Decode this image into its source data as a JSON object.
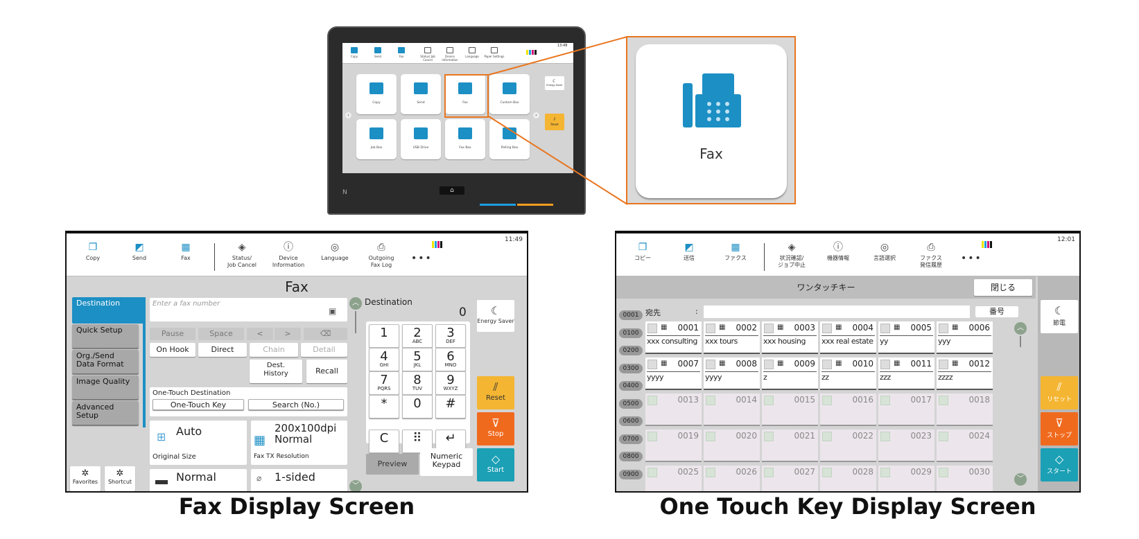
{
  "device": {
    "topbar": [
      "Copy",
      "Send",
      "Fax",
      "Status/ Job Cancel",
      "Device Information",
      "Language",
      "Paper Settings"
    ],
    "clock": "13:48",
    "tiles": [
      "Copy",
      "Send",
      "Fax",
      "Custom Box",
      "Job Box",
      "USB Drive",
      "Fax Box",
      "Polling Box"
    ],
    "side": {
      "energy": "Energy Saver",
      "reset": "Reset"
    }
  },
  "callout": {
    "label": "Fax",
    "icon": "fax-icon"
  },
  "fax_screen": {
    "caption": "Fax Display Screen",
    "clock": "11:49",
    "ink_colors": [
      "#f2e400",
      "#1c9fe0",
      "#d4147a",
      "#111111"
    ],
    "topbar": [
      {
        "label": "Copy",
        "icon": "copy-icon"
      },
      {
        "label": "Send",
        "icon": "send-icon"
      },
      {
        "label": "Fax",
        "icon": "fax-icon"
      },
      {
        "label": "Status/\nJob Cancel",
        "icon": "eye-icon"
      },
      {
        "label": "Device\nInformation",
        "icon": "info-icon"
      },
      {
        "label": "Language",
        "icon": "language-icon"
      },
      {
        "label": "Outgoing\nFax Log",
        "icon": "fax-log-icon"
      }
    ],
    "more": "•••",
    "title": "Fax",
    "tabs": [
      "Destination",
      "Quick Setup",
      "Org./Send Data Format",
      "Image Quality",
      "Advanced Setup"
    ],
    "input_placeholder": "Enter a fax number",
    "edit_buttons": [
      "Pause",
      "Space",
      "<",
      ">",
      "⌫"
    ],
    "mode_buttons": [
      "On Hook",
      "Direct",
      "Chain",
      "Detail"
    ],
    "dest_history": "Dest.\nHistory",
    "recall": "Recall",
    "one_touch_label": "One-Touch Destination",
    "one_touch_key": "One-Touch Key",
    "search_no": "Search (No.)",
    "original_size_value": "Auto",
    "original_size_label": "Original Size",
    "resolution_value": "200x100dpi\nNormal",
    "resolution_label": "Fax TX Resolution",
    "density_value": "Normal",
    "duplex_value": "1-sided",
    "destination_label": "Destination",
    "destination_count": "0",
    "keypad": [
      {
        "n": "1",
        "l": ""
      },
      {
        "n": "2",
        "l": "ABC"
      },
      {
        "n": "3",
        "l": "DEF"
      },
      {
        "n": "4",
        "l": "GHI"
      },
      {
        "n": "5",
        "l": "JKL"
      },
      {
        "n": "6",
        "l": "MNO"
      },
      {
        "n": "7",
        "l": "PQRS"
      },
      {
        "n": "8",
        "l": "TUV"
      },
      {
        "n": "9",
        "l": "WXYZ"
      },
      {
        "n": "*",
        "l": ""
      },
      {
        "n": "0",
        "l": ""
      },
      {
        "n": "#",
        "l": ""
      },
      {
        "n": "C",
        "l": ""
      },
      {
        "n": "⠿",
        "l": ""
      },
      {
        "n": "↵",
        "l": ""
      }
    ],
    "preview": "Preview",
    "numeric_keypad": "Numeric\nKeypad",
    "favorites": "Favorites",
    "shortcut": "Shortcut",
    "side": {
      "energy": "Energy Saver",
      "reset": "Reset",
      "stop": "Stop",
      "start": "Start"
    }
  },
  "otk_screen": {
    "caption": "One Touch Key Display Screen",
    "clock": "12:01",
    "topbar": [
      {
        "label": "コピー",
        "icon": "copy-icon"
      },
      {
        "label": "送信",
        "icon": "send-icon"
      },
      {
        "label": "ファクス",
        "icon": "fax-icon"
      },
      {
        "label": "状況確認/\nジョブ中止",
        "icon": "eye-icon"
      },
      {
        "label": "機器情報",
        "icon": "info-icon"
      },
      {
        "label": "言語選択",
        "icon": "language-icon"
      },
      {
        "label": "ファクス\n発信履歴",
        "icon": "fax-log-icon"
      }
    ],
    "more": "•••",
    "title": "ワンタッチキー",
    "close": "閉じる",
    "dest_label": "宛先",
    "dest_colon": ":",
    "number_button": "番号",
    "index_tabs": [
      "0001",
      "0100",
      "0200",
      "0300",
      "0400",
      "0500",
      "0600",
      "0700",
      "0800",
      "0900"
    ],
    "keys": [
      {
        "num": "0001",
        "name": "xxx consulting"
      },
      {
        "num": "0002",
        "name": "xxx tours"
      },
      {
        "num": "0003",
        "name": "xxx housing"
      },
      {
        "num": "0004",
        "name": "xxx real estate"
      },
      {
        "num": "0005",
        "name": "yy"
      },
      {
        "num": "0006",
        "name": "yyy"
      },
      {
        "num": "0007",
        "name": "yyyy"
      },
      {
        "num": "0008",
        "name": "yyyy"
      },
      {
        "num": "0009",
        "name": "z"
      },
      {
        "num": "0010",
        "name": "zz"
      },
      {
        "num": "0011",
        "name": "zzz"
      },
      {
        "num": "0012",
        "name": "zzzz"
      },
      {
        "num": "0013",
        "name": ""
      },
      {
        "num": "0014",
        "name": ""
      },
      {
        "num": "0015",
        "name": ""
      },
      {
        "num": "0016",
        "name": ""
      },
      {
        "num": "0017",
        "name": ""
      },
      {
        "num": "0018",
        "name": ""
      },
      {
        "num": "0019",
        "name": ""
      },
      {
        "num": "0020",
        "name": ""
      },
      {
        "num": "0021",
        "name": ""
      },
      {
        "num": "0022",
        "name": ""
      },
      {
        "num": "0023",
        "name": ""
      },
      {
        "num": "0024",
        "name": ""
      },
      {
        "num": "0025",
        "name": ""
      },
      {
        "num": "0026",
        "name": ""
      },
      {
        "num": "0027",
        "name": ""
      },
      {
        "num": "0028",
        "name": ""
      },
      {
        "num": "0029",
        "name": ""
      },
      {
        "num": "0030",
        "name": ""
      }
    ],
    "side": {
      "energy": "節電",
      "reset": "リセット",
      "stop": "ストップ",
      "start": "スタート"
    }
  },
  "colors": {
    "accent": "#1c8fc4",
    "highlight": "#e8761f",
    "reset": "#f4b532",
    "stop": "#f06a1e",
    "start": "#1ba0b5"
  }
}
